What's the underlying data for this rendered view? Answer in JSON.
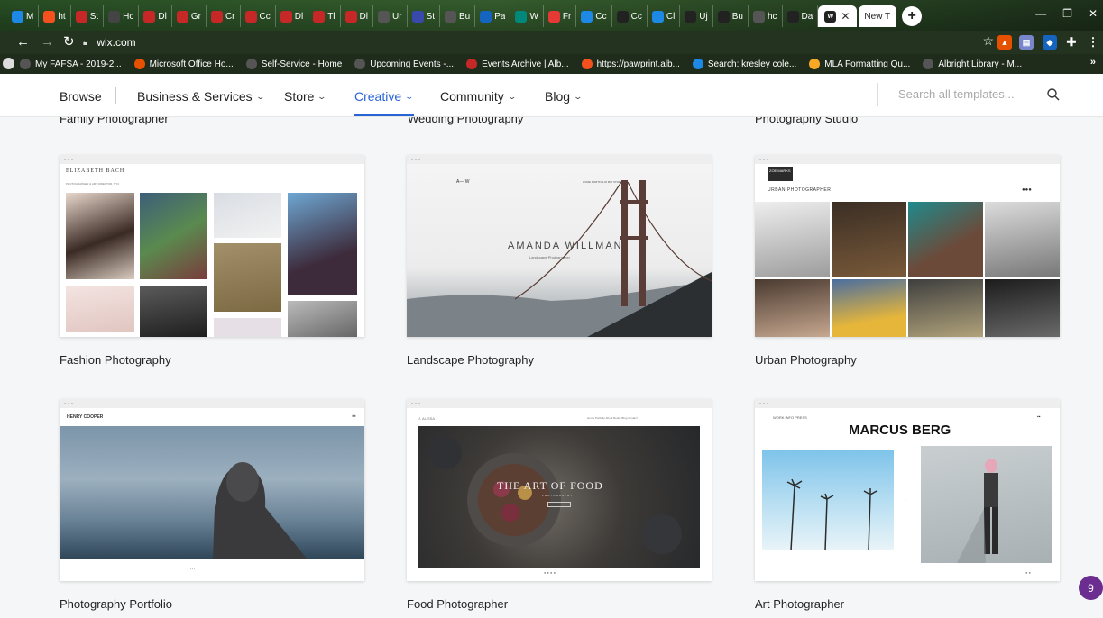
{
  "browser": {
    "tabs": [
      {
        "label": "M",
        "color": "#1e88e5",
        "icon": "mail-icon"
      },
      {
        "label": "ht",
        "color": "#f4511e",
        "icon": "link-icon"
      },
      {
        "label": "St",
        "color": "#c62828",
        "icon": "college-icon"
      },
      {
        "label": "Hc",
        "color": "#444444",
        "icon": "ww-icon"
      },
      {
        "label": "Dl",
        "color": "#c62828",
        "icon": "college-icon"
      },
      {
        "label": "Gr",
        "color": "#c62828",
        "icon": "college-icon"
      },
      {
        "label": "Cr",
        "color": "#c62828",
        "icon": "college-icon"
      },
      {
        "label": "Cc",
        "color": "#c62828",
        "icon": "college-icon"
      },
      {
        "label": "Dl",
        "color": "#c62828",
        "icon": "college-icon"
      },
      {
        "label": "Tl",
        "color": "#c62828",
        "icon": "college-icon"
      },
      {
        "label": "Dl",
        "color": "#c62828",
        "icon": "college-icon"
      },
      {
        "label": "Ur",
        "color": "#555555",
        "icon": "google-icon"
      },
      {
        "label": "St",
        "color": "#3949ab",
        "icon": "d-icon"
      },
      {
        "label": "Bu",
        "color": "#555555",
        "icon": "google-icon"
      },
      {
        "label": "Pa",
        "color": "#1565c0",
        "icon": "wordpress-icon"
      },
      {
        "label": "W",
        "color": "#00897b",
        "icon": "wordpress-icon"
      },
      {
        "label": "Fr",
        "color": "#e53935",
        "icon": "doc-icon"
      },
      {
        "label": "Cc",
        "color": "#1e88e5",
        "icon": "docs-icon"
      },
      {
        "label": "Cc",
        "color": "#222222",
        "icon": "wix-icon"
      },
      {
        "label": "Cl",
        "color": "#1e88e5",
        "icon": "docs-icon"
      },
      {
        "label": "Uj",
        "color": "#222222",
        "icon": "wix-icon"
      },
      {
        "label": "Bu",
        "color": "#222222",
        "icon": "wix-icon"
      },
      {
        "label": "hc",
        "color": "#555555",
        "icon": "google-icon"
      },
      {
        "label": "Da",
        "color": "#222222",
        "icon": "wix-icon"
      }
    ],
    "active_tab": {
      "label": "",
      "icon": "wix-icon",
      "color": "#222222"
    },
    "new_tab": {
      "label": "New T"
    },
    "url": "wix.com",
    "bookmarks": [
      {
        "label": "My FAFSA - 2019-2...",
        "color": "#555555",
        "icon": "globe-icon"
      },
      {
        "label": "Microsoft Office Ho...",
        "color": "#e65100",
        "icon": "office-icon"
      },
      {
        "label": "Self-Service - Home",
        "color": "#555555",
        "icon": "globe-icon"
      },
      {
        "label": "Upcoming Events -...",
        "color": "#555555",
        "icon": "globe-icon"
      },
      {
        "label": "Events Archive | Alb...",
        "color": "#c62828",
        "icon": "shield-icon"
      },
      {
        "label": "https://pawprint.alb...",
        "color": "#f4511e",
        "icon": "link-icon"
      },
      {
        "label": "Search: kresley cole...",
        "color": "#1e88e5",
        "icon": "search-dot-icon"
      },
      {
        "label": "MLA Formatting Qu...",
        "color": "#f9a825",
        "icon": "library-icon"
      },
      {
        "label": "Albright Library - M...",
        "color": "#555555",
        "icon": "globe-icon"
      }
    ]
  },
  "site_nav": {
    "items": [
      {
        "label": "Browse",
        "has_chevron": false
      },
      {
        "label": "Business & Services",
        "has_chevron": true
      },
      {
        "label": "Store",
        "has_chevron": true
      },
      {
        "label": "Creative",
        "has_chevron": true,
        "active": true
      },
      {
        "label": "Community",
        "has_chevron": true
      },
      {
        "label": "Blog",
        "has_chevron": true
      }
    ],
    "search_placeholder": "Search all templates...",
    "accent_color": "#2a63d6"
  },
  "cutoff_titles": [
    "Family Photographer",
    "Wedding Photography",
    "Photography Studio"
  ],
  "templates": [
    {
      "title": "Fashion Photography",
      "preview": {
        "brand": "ELIZABETH BACH",
        "subtitle": "PHOTOGRAPHER & ART DIRECTOR, NYC"
      }
    },
    {
      "title": "Landscape Photography",
      "preview": {
        "brand": "A— W",
        "headline": "AMANDA WILLMAN",
        "subtitle": "Landscape Photographer",
        "menu": "HOME  PORTFOLIO  BIO  STORE"
      }
    },
    {
      "title": "Urban Photography",
      "preview": {
        "brand": "ZOE MARKS",
        "headline": "URBAN PHOTOGRAPHER"
      }
    },
    {
      "title": "Photography Portfolio",
      "preview": {
        "brand": "HENRY COOPER"
      }
    },
    {
      "title": "Food Photographer",
      "preview": {
        "brand": "J. ALISSA",
        "headline": "THE ART OF FOOD",
        "subtitle": "PHOTOGRAPHY"
      }
    },
    {
      "title": "Art Photographer",
      "preview": {
        "brand": "MARCUS BERG",
        "menu": "WORK  INFO  PRESS"
      }
    }
  ],
  "chat_badge": "9"
}
